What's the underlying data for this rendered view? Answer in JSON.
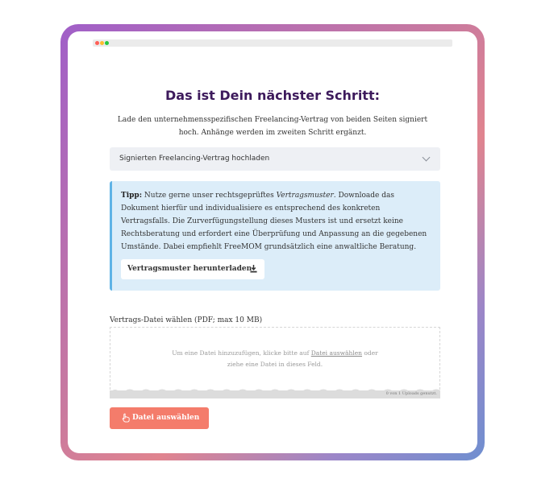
{
  "page": {
    "title": "Das ist Dein nächster Schritt:",
    "intro": "Lade den unternehmensspezifischen Freelancing-Vertrag von beiden Seiten signiert hoch. Anhänge werden im zweiten Schritt ergänzt."
  },
  "accordion": {
    "label": "Signierten Freelancing-Vertrag hochladen",
    "icon": "chevron-down-icon"
  },
  "tip": {
    "prefix": "Tipp:",
    "text_1": " Nutze gerne unser rechtsgeprüftes ",
    "emphasis": "Vertragsmuster",
    "text_2": ". Downloade das Dokument hierfür und individualisiere es entsprechend des konkreten Vertragsfalls. Die Zurverfügungstellung dieses Musters ist und ersetzt keine Rechtsberatung und erfordert eine Überprüfung und Anpassung an die gegebenen Umstände. Dabei empfiehlt FreeMOM grundsätzlich eine anwaltliche Beratung.",
    "download_label": "Vertragsmuster herunterladen",
    "download_icon": "download-icon"
  },
  "upload": {
    "field_label": "Vertrags-Datei wählen (PDF; max 10 MB)",
    "drop_text_1": "Um eine Datei hinzuzufügen, klicke bitte auf ",
    "drop_link": "Datei auswählen",
    "drop_text_2": " oder",
    "drop_text_3": "ziehe eine Datei in dieses Feld.",
    "status": "0 von 1 Uploads genutzt.",
    "button_label": "Datei auswählen",
    "button_icon": "pointer-hand-icon"
  },
  "colors": {
    "title": "#3d1a5c",
    "tip_background": "#dcedf9",
    "tip_border": "#5fb3e6",
    "upload_button": "#f47c6b"
  }
}
